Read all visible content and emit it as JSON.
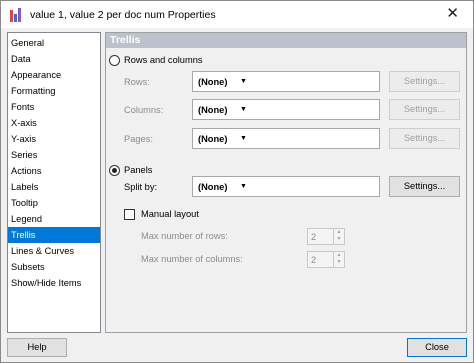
{
  "window": {
    "title": "value 1, value 2 per doc num Properties"
  },
  "sidebar": {
    "items": [
      {
        "label": "General"
      },
      {
        "label": "Data"
      },
      {
        "label": "Appearance"
      },
      {
        "label": "Formatting"
      },
      {
        "label": "Fonts"
      },
      {
        "label": "X-axis"
      },
      {
        "label": "Y-axis"
      },
      {
        "label": "Series"
      },
      {
        "label": "Actions"
      },
      {
        "label": "Labels"
      },
      {
        "label": "Tooltip"
      },
      {
        "label": "Legend"
      },
      {
        "label": "Trellis"
      },
      {
        "label": "Lines & Curves"
      },
      {
        "label": "Subsets"
      },
      {
        "label": "Show/Hide Items"
      }
    ],
    "selected": "Trellis"
  },
  "panel": {
    "header": "Trellis",
    "rows_columns": {
      "label": "Rows and columns",
      "selected": false,
      "rows": {
        "label": "Rows:",
        "value": "(None)",
        "settings": "Settings..."
      },
      "columns": {
        "label": "Columns:",
        "value": "(None)",
        "settings": "Settings..."
      },
      "pages": {
        "label": "Pages:",
        "value": "(None)",
        "settings": "Settings..."
      }
    },
    "panels": {
      "label": "Panels",
      "selected": true,
      "split_by": {
        "label": "Split by:",
        "value": "(None)",
        "settings": "Settings..."
      },
      "manual_layout": {
        "label": "Manual layout",
        "checked": false
      },
      "max_rows": {
        "label": "Max number of rows:",
        "value": "2"
      },
      "max_columns": {
        "label": "Max number of columns:",
        "value": "2"
      }
    }
  },
  "footer": {
    "help": "Help",
    "close": "Close"
  },
  "colors": {
    "selection": "#0078d7",
    "header_bg": "#bcc2cc"
  }
}
